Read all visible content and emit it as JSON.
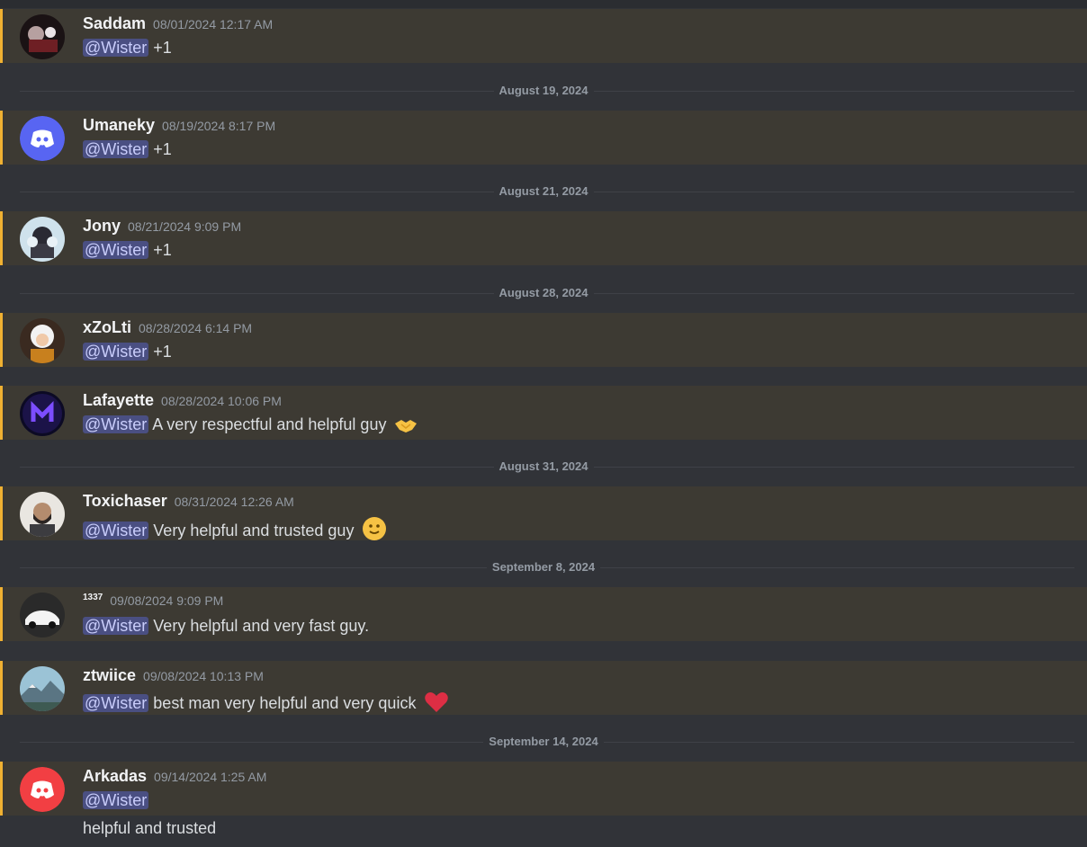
{
  "messages": [
    {
      "author": "Saddam",
      "timestamp": "08/01/2024 12:17 AM",
      "mention": "@Wister",
      "text": "+1"
    },
    {
      "author": "Umaneky",
      "timestamp": "08/19/2024 8:17 PM",
      "mention": "@Wister",
      "text": "+1"
    },
    {
      "author": "Jony",
      "timestamp": "08/21/2024 9:09 PM",
      "mention": "@Wister",
      "text": "+1"
    },
    {
      "author": "xZoLti",
      "timestamp": "08/28/2024 6:14 PM",
      "mention": "@Wister",
      "text": "+1"
    },
    {
      "author": "Lafayette",
      "timestamp": "08/28/2024 10:06 PM",
      "mention": "@Wister",
      "text": "A very respectful and helpful guy",
      "emoji": "handshake"
    },
    {
      "author": "Toxichaser",
      "timestamp": "08/31/2024 12:26 AM",
      "mention": "@Wister",
      "text": "Very helpful and trusted guy",
      "emoji": "slight-smile"
    },
    {
      "author": "1337",
      "timestamp": "09/08/2024 9:09 PM",
      "mention": "@Wister",
      "text": "Very helpful and very fast guy."
    },
    {
      "author": "ztwiice",
      "timestamp": "09/08/2024 10:13 PM",
      "mention": "@Wister",
      "text": "best man very helpful and very quick",
      "emoji": "red-heart"
    },
    {
      "author": "Arkadas",
      "timestamp": "09/14/2024 1:25 AM",
      "mention": "@Wister",
      "text": "",
      "extra_line": "helpful and trusted"
    }
  ],
  "dividers": [
    "August 19, 2024",
    "August 21, 2024",
    "August 28, 2024",
    "August 31, 2024",
    "September 8, 2024",
    "September 14, 2024"
  ],
  "colors": {
    "highlight_bar": "#f0b132",
    "highlight_bg": "#3d3a33",
    "mention_bg": "#4a4f82",
    "background": "#313338",
    "discord_blurple": "#5865f2",
    "discord_red": "#f23f43"
  }
}
